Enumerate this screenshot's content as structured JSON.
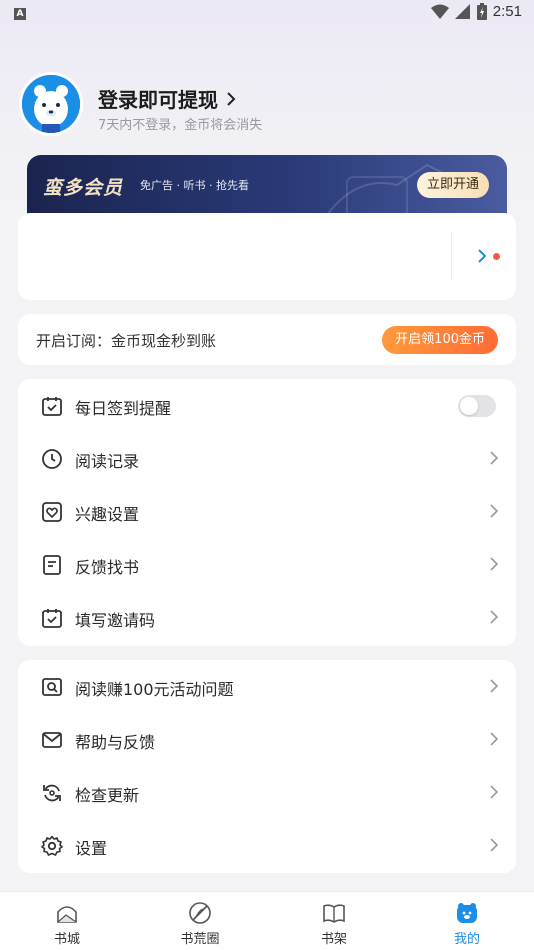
{
  "status_bar": {
    "indicator": "A",
    "time": "2:51"
  },
  "profile": {
    "login_title": "登录即可提现",
    "login_subtitle": "7天内不登录，金币将会消失"
  },
  "vip": {
    "title": "蛮多会员",
    "desc": "免广告 · 听书 · 抢先看",
    "button": "立即开通"
  },
  "subscribe": {
    "text": "开启订阅：金币现金秒到账",
    "button": "开启领100金币"
  },
  "menu_group_1": [
    {
      "label": "每日签到提醒",
      "icon": "calendar-check-icon",
      "control": "toggle",
      "enabled": false
    },
    {
      "label": "阅读记录",
      "icon": "clock-icon",
      "control": "chevron"
    },
    {
      "label": "兴趣设置",
      "icon": "heart-box-icon",
      "control": "chevron"
    },
    {
      "label": "反馈找书",
      "icon": "document-icon",
      "control": "chevron"
    },
    {
      "label": "填写邀请码",
      "icon": "calendar-check-icon",
      "control": "chevron"
    }
  ],
  "menu_group_2": [
    {
      "label": "阅读赚100元活动问题",
      "icon": "search-box-icon",
      "control": "chevron"
    },
    {
      "label": "帮助与反馈",
      "icon": "mail-icon",
      "control": "chevron"
    },
    {
      "label": "检查更新",
      "icon": "refresh-icon",
      "control": "chevron"
    },
    {
      "label": "设置",
      "icon": "gear-icon",
      "control": "chevron"
    }
  ],
  "bottom_nav": [
    {
      "label": "书城",
      "icon": "home-icon",
      "active": false
    },
    {
      "label": "书荒圈",
      "icon": "compass-icon",
      "active": false
    },
    {
      "label": "书架",
      "icon": "book-icon",
      "active": false
    },
    {
      "label": "我的",
      "icon": "bear-icon",
      "active": true
    }
  ],
  "colors": {
    "accent": "#1b8ee6",
    "promo_orange": "#ff6b35",
    "vip_dark": "#1b2450"
  }
}
